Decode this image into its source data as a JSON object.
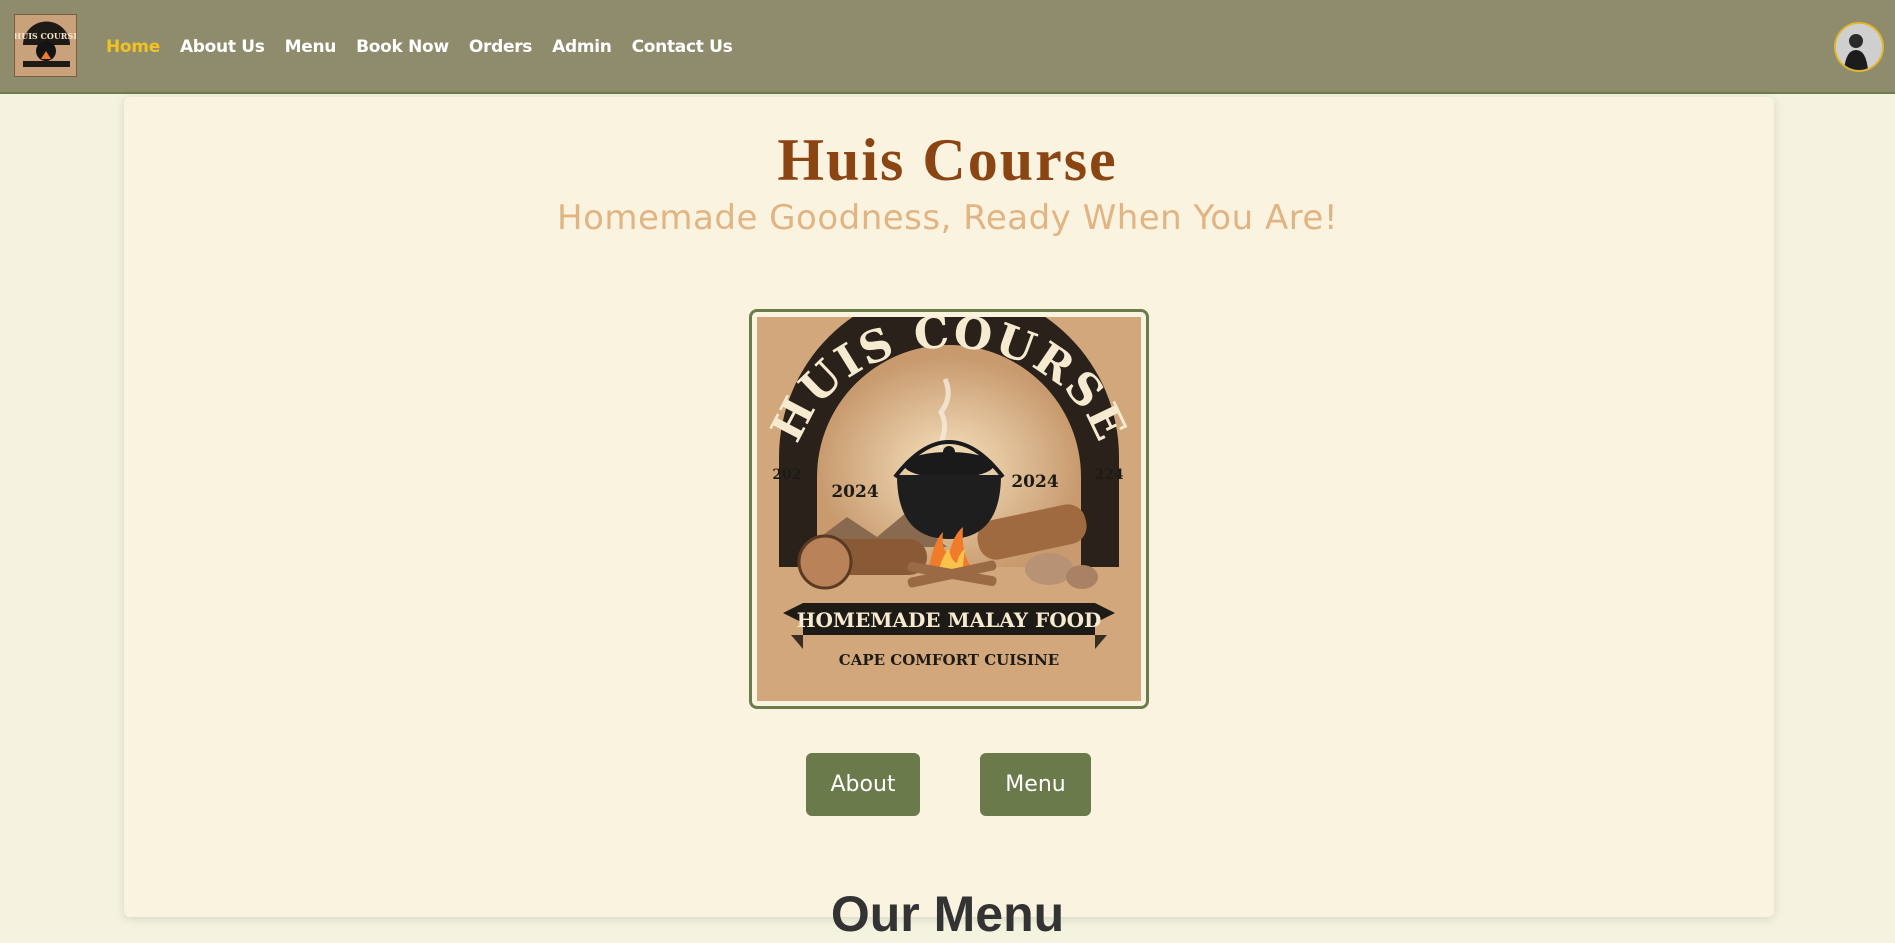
{
  "nav": {
    "logo_icon": "huis-course-logo",
    "links": [
      {
        "label": "Home",
        "active": true
      },
      {
        "label": "About Us",
        "active": false
      },
      {
        "label": "Menu",
        "active": false
      },
      {
        "label": "Book Now",
        "active": false
      },
      {
        "label": "Orders",
        "active": false
      },
      {
        "label": "Admin",
        "active": false
      },
      {
        "label": "Contact Us",
        "active": false
      }
    ],
    "avatar_icon": "user-avatar"
  },
  "hero": {
    "title": "Huis Course",
    "tagline": "Homemade Goodness, Ready When You Are!",
    "logo": {
      "brand": "HUIS COURSE",
      "year_left": "2024",
      "year_right": "2024",
      "side_left": "202",
      "side_right": "224",
      "banner": "HOMEMADE MALAY FOOD",
      "sub": "CAPE COMFORT CUISINE"
    }
  },
  "buttons": {
    "about": "About",
    "menu": "Menu"
  },
  "section": {
    "heading": "Our Menu"
  },
  "colors": {
    "navbar": "#8f8b6d",
    "active_link": "#f2c224",
    "title": "#8b4513",
    "tagline": "#e0b483",
    "button": "#6b7a4b",
    "card": "#faf3e0",
    "page_bg": "#f4f3df"
  }
}
